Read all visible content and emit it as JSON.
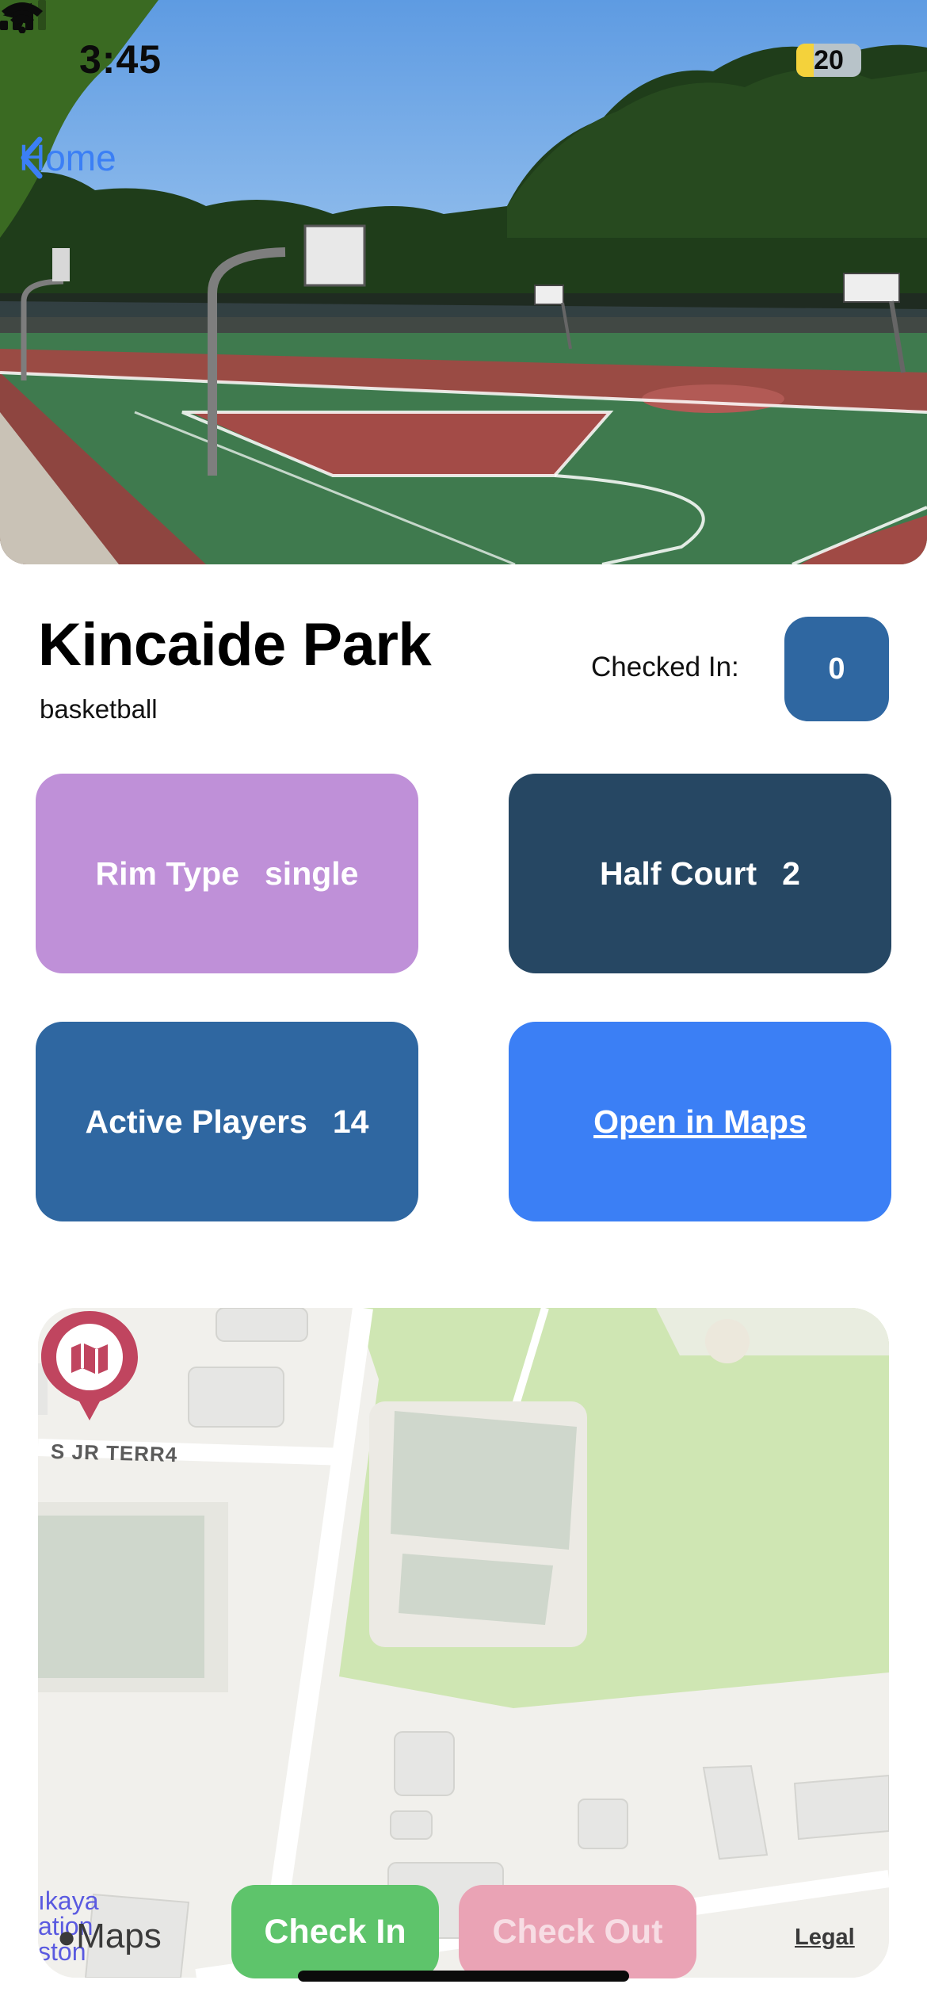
{
  "status_bar": {
    "time": "3:45",
    "battery": "20",
    "location_icon": "location-arrow-icon",
    "signal_icon": "cellular-signal-icon",
    "wifi_icon": "wifi-icon"
  },
  "nav": {
    "back_label": "Home",
    "back_icon": "chevron-left-icon"
  },
  "park": {
    "name": "Kincaide Park",
    "sport": "basketball",
    "checked_in_label": "Checked In:",
    "checked_in_count": "0"
  },
  "tiles": {
    "rim_type_label": "Rim Type",
    "rim_type_value": "single",
    "half_court_label": "Half Court",
    "half_court_value": "2",
    "active_players_label": "Active Players",
    "active_players_value": "14",
    "open_maps_label": "Open in Maps"
  },
  "map": {
    "street_label": "S JR TERR4",
    "fragment_1": "ıkaya",
    "fragment_2": "ation",
    "fragment_3": "ston",
    "logo_text": "Maps",
    "legal_label": "Legal",
    "pin_icon": "map-marker-icon"
  },
  "actions": {
    "check_in_label": "Check In",
    "check_out_label": "Check Out"
  },
  "colors": {
    "accent_blue": "#3b7ff5",
    "rim_tile": "#bf90d8",
    "half_court_tile": "#264763",
    "active_players_tile": "#2f67a1",
    "check_in": "#5ec46b",
    "check_out_disabled": "#eaa3b5",
    "pin": "#c0455f"
  }
}
